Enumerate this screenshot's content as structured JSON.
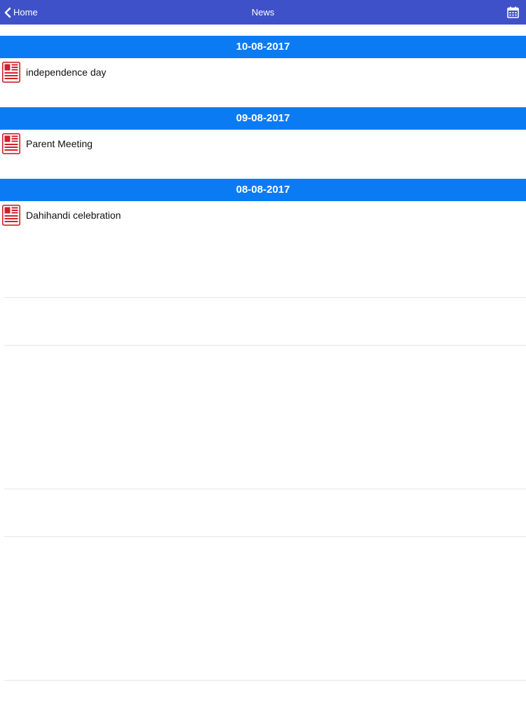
{
  "nav": {
    "back_label": "Home",
    "title": "News",
    "calendar_icon": "calendar-icon",
    "back_icon": "chevron-left-icon"
  },
  "news_sections": [
    {
      "date": "10-08-2017",
      "items": [
        {
          "title": "independence day",
          "icon": "newspaper-icon"
        }
      ]
    },
    {
      "date": "09-08-2017",
      "items": [
        {
          "title": "Parent Meeting",
          "icon": "newspaper-icon"
        }
      ]
    },
    {
      "date": "08-08-2017",
      "items": [
        {
          "title": "Dahihandi celebration",
          "icon": "newspaper-icon"
        }
      ]
    }
  ],
  "colors": {
    "nav_bar": "#3f51c8",
    "section_header": "#0b7bf4",
    "news_icon": "#d0202a"
  }
}
